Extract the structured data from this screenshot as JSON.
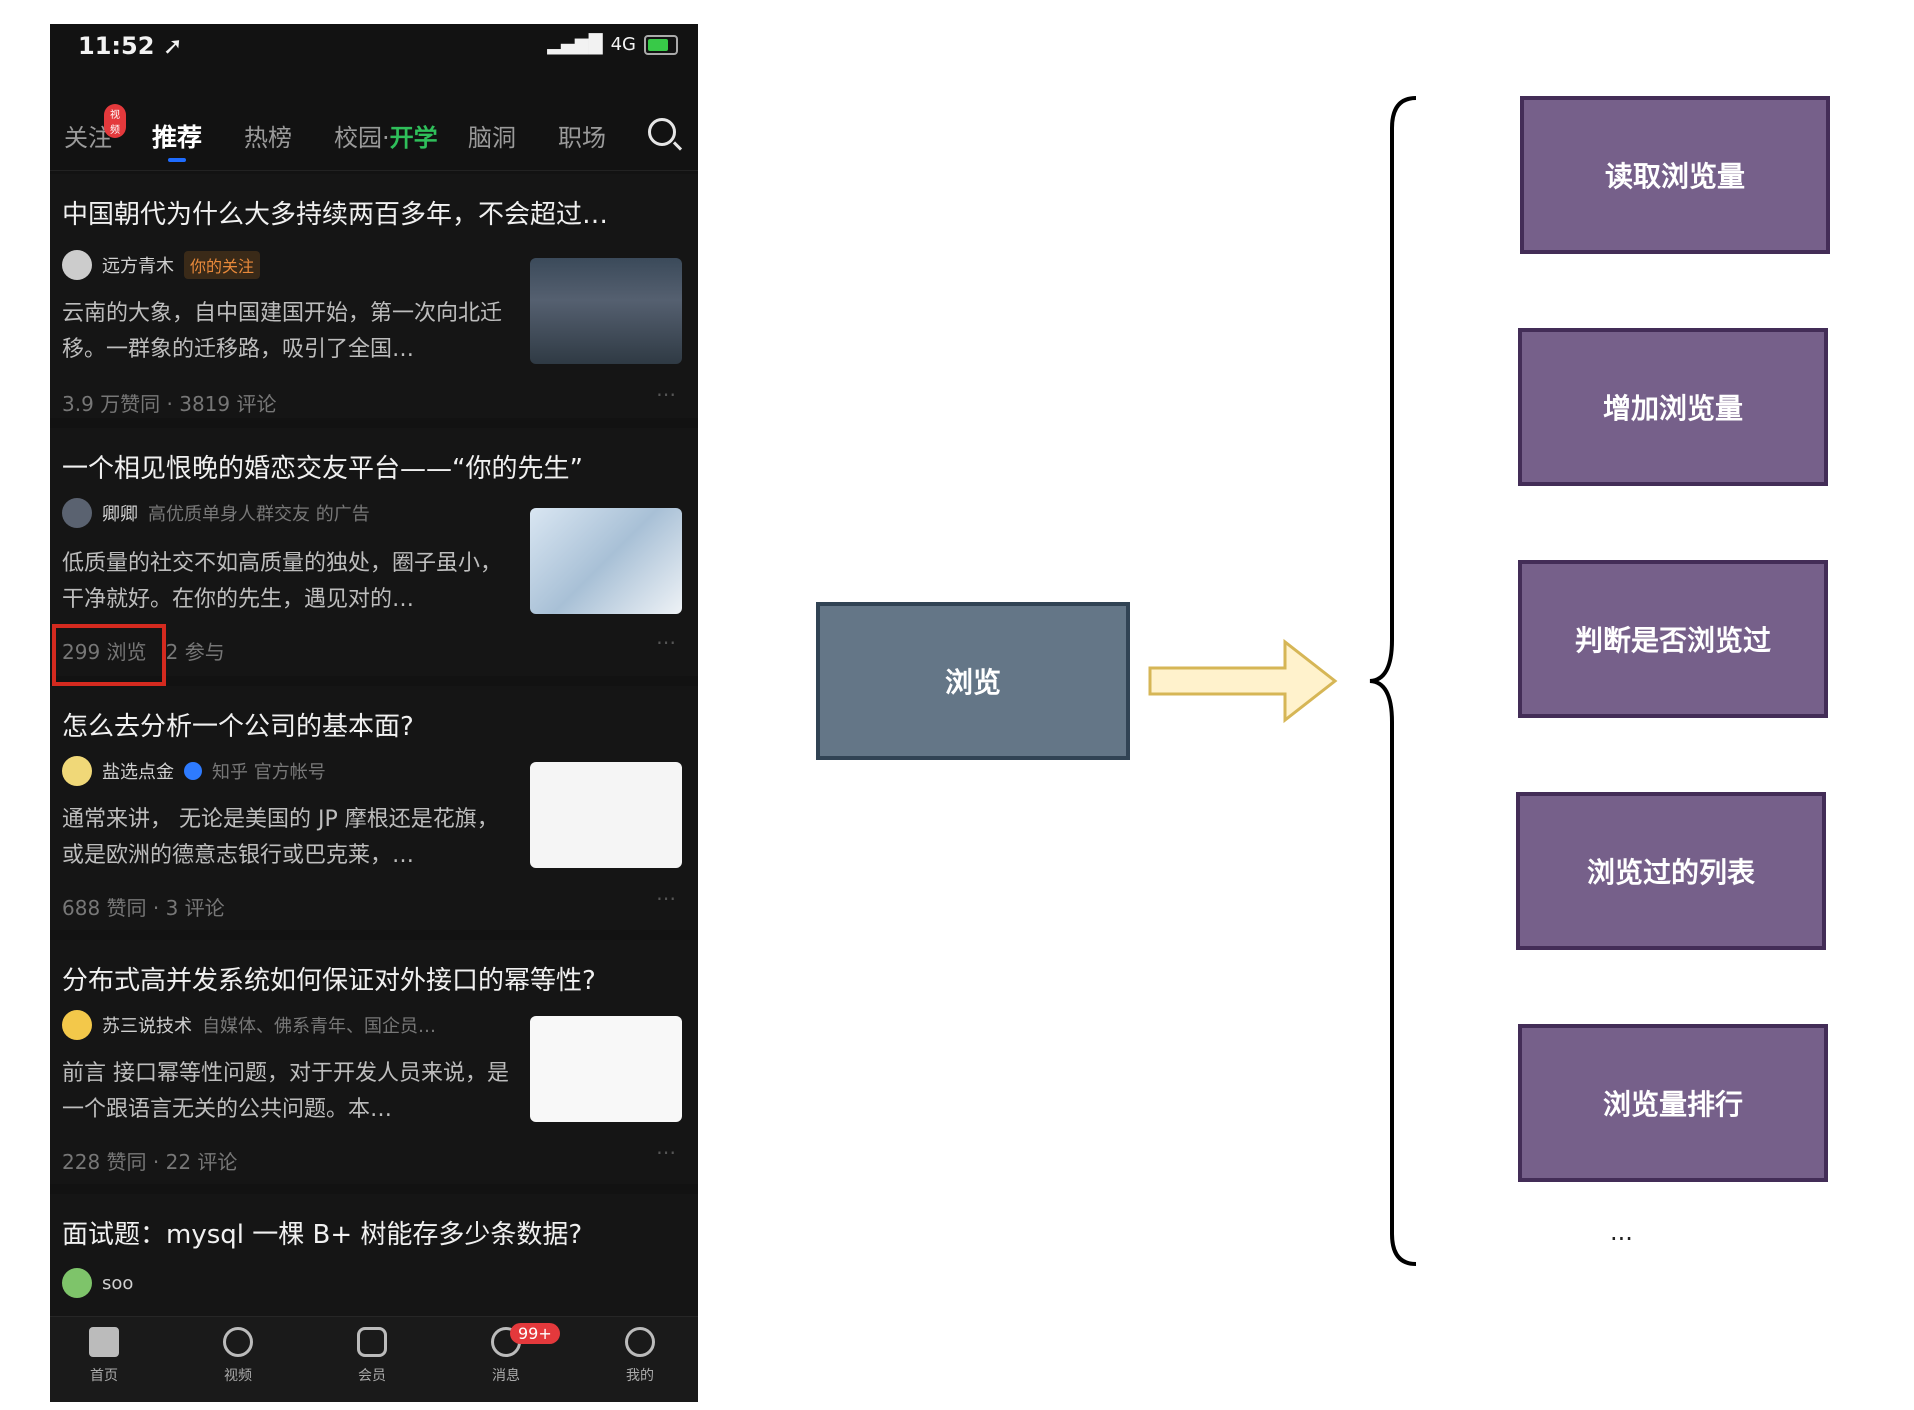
{
  "phone": {
    "status": {
      "time": "11:52 ➚",
      "network": "4G"
    },
    "tabs": [
      {
        "label": "关注",
        "badge": "视频"
      },
      {
        "label": "推荐"
      },
      {
        "label": "热榜"
      },
      {
        "label_a": "校园·",
        "label_b": "开学"
      },
      {
        "label": "脑洞"
      },
      {
        "label": "职场"
      }
    ],
    "feed": [
      {
        "title": "中国朝代为什么大多持续两百多年，不会超过…",
        "author": "远方青木",
        "author_tag": "你的关注",
        "excerpt": "云南的大象，自中国建国开始，第一次向北迁移。一群象的迁移路，吸引了全国…",
        "meta": "3.9 万赞同 · 3819 评论"
      },
      {
        "title": "一个相见恨晚的婚恋交友平台——“你的先生”",
        "author": "卿卿",
        "author_tag": "高优质单身人群交友 的广告",
        "excerpt": "低质量的社交不如高质量的独处，圈子虽小，干净就好。在你的先生，遇见对的…",
        "views": "299 浏览",
        "meta": "2 参与"
      },
      {
        "title": "怎么去分析一个公司的基本面?",
        "author": "盐选点金",
        "author_tag": "知乎 官方帐号",
        "excerpt": "通常来讲， 无论是美国的 JP 摩根还是花旗，或是欧洲的德意志银行或巴克莱，…",
        "meta": "688 赞同 · 3 评论"
      },
      {
        "title": "分布式高并发系统如何保证对外接口的幂等性?",
        "author": "苏三说技术",
        "author_tag": "自媒体、佛系青年、国企员…",
        "excerpt": "前言 接口幂等性问题，对于开发人员来说，是一个跟语言无关的公共问题。本…",
        "meta": "228 赞同 · 22 评论"
      },
      {
        "title": "面试题：mysql 一棵 B+ 树能存多少条数据?",
        "author": "soo"
      }
    ],
    "bottom_nav": [
      {
        "label": "首页",
        "icon": "home-icon"
      },
      {
        "label": "视频",
        "icon": "play-icon"
      },
      {
        "label": "会员",
        "icon": "vip-icon"
      },
      {
        "label": "消息",
        "icon": "bell-icon",
        "badge": "99+"
      },
      {
        "label": "我的",
        "icon": "profile-icon"
      }
    ]
  },
  "diagram": {
    "source_node": "浏览",
    "child_nodes": [
      "读取浏览量",
      "增加浏览量",
      "判断是否浏览过",
      "浏览过的列表",
      "浏览量排行"
    ],
    "more": "...",
    "colors": {
      "source_fill": "#647687",
      "source_border": "#314354",
      "child_fill": "#76608a",
      "child_border": "#432d57",
      "arrow_fill": "#fff2cc",
      "arrow_border": "#d6b656"
    }
  }
}
